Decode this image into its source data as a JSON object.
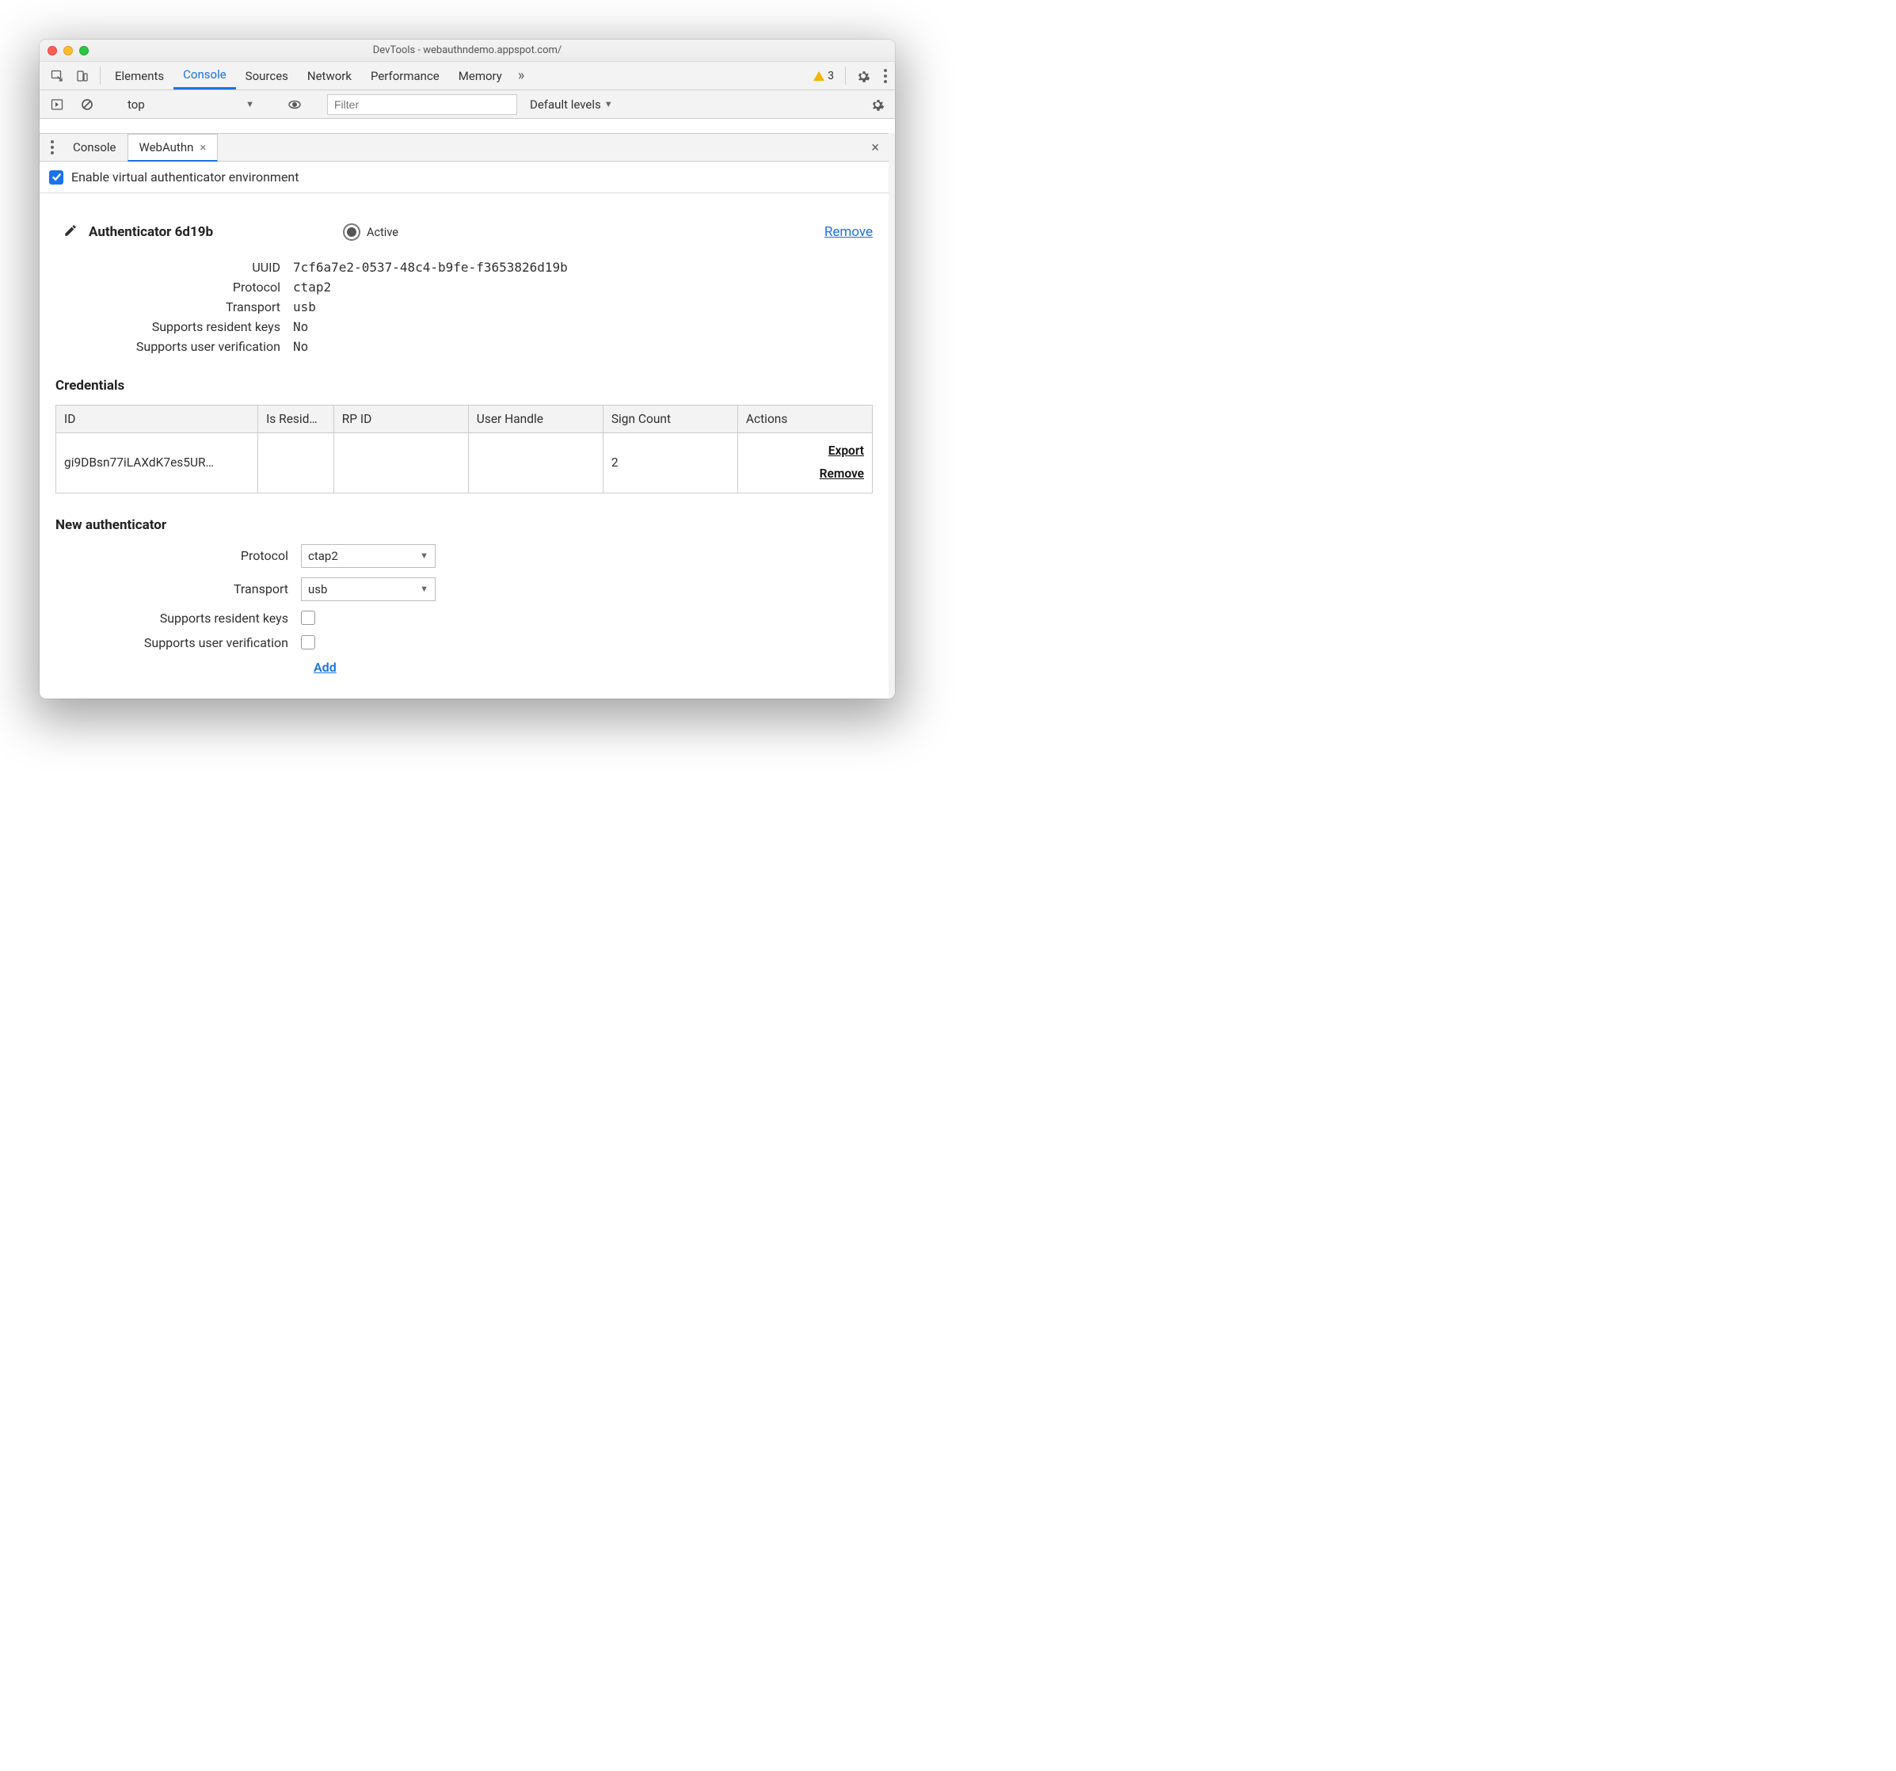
{
  "window": {
    "title": "DevTools - webauthndemo.appspot.com/"
  },
  "tabs": {
    "items": [
      "Elements",
      "Console",
      "Sources",
      "Network",
      "Performance",
      "Memory"
    ],
    "active": "Console",
    "warning_count": "3"
  },
  "console_toolbar": {
    "context": "top",
    "filter_placeholder": "Filter",
    "levels": "Default levels"
  },
  "drawer": {
    "tabs": [
      "Console",
      "WebAuthn"
    ],
    "active": "WebAuthn"
  },
  "enable_label": "Enable virtual authenticator environment",
  "authenticator": {
    "name": "Authenticator 6d19b",
    "active_label": "Active",
    "remove_label": "Remove",
    "fields": {
      "uuid_label": "UUID",
      "uuid_value": "7cf6a7e2-0537-48c4-b9fe-f3653826d19b",
      "protocol_label": "Protocol",
      "protocol_value": "ctap2",
      "transport_label": "Transport",
      "transport_value": "usb",
      "srk_label": "Supports resident keys",
      "srk_value": "No",
      "suv_label": "Supports user verification",
      "suv_value": "No"
    }
  },
  "credentials": {
    "title": "Credentials",
    "headers": {
      "id": "ID",
      "is_resident": "Is Resid…",
      "rp_id": "RP ID",
      "user_handle": "User Handle",
      "sign_count": "Sign Count",
      "actions": "Actions"
    },
    "rows": [
      {
        "id": "gi9DBsn77iLAXdK7es5UR…",
        "is_resident": "",
        "rp_id": "",
        "user_handle": "",
        "sign_count": "2"
      }
    ],
    "export_label": "Export",
    "remove_label": "Remove"
  },
  "new_auth": {
    "title": "New authenticator",
    "protocol_label": "Protocol",
    "protocol_value": "ctap2",
    "transport_label": "Transport",
    "transport_value": "usb",
    "srk_label": "Supports resident keys",
    "suv_label": "Supports user verification",
    "add_label": "Add"
  }
}
